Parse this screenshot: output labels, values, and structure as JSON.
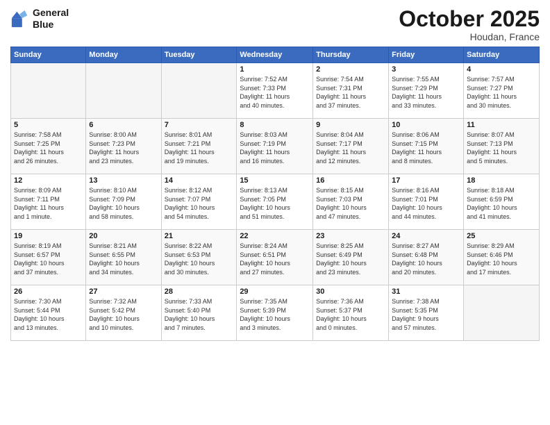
{
  "header": {
    "logo_line1": "General",
    "logo_line2": "Blue",
    "month": "October 2025",
    "location": "Houdan, France"
  },
  "weekdays": [
    "Sunday",
    "Monday",
    "Tuesday",
    "Wednesday",
    "Thursday",
    "Friday",
    "Saturday"
  ],
  "weeks": [
    [
      {
        "day": "",
        "info": ""
      },
      {
        "day": "",
        "info": ""
      },
      {
        "day": "",
        "info": ""
      },
      {
        "day": "1",
        "info": "Sunrise: 7:52 AM\nSunset: 7:33 PM\nDaylight: 11 hours\nand 40 minutes."
      },
      {
        "day": "2",
        "info": "Sunrise: 7:54 AM\nSunset: 7:31 PM\nDaylight: 11 hours\nand 37 minutes."
      },
      {
        "day": "3",
        "info": "Sunrise: 7:55 AM\nSunset: 7:29 PM\nDaylight: 11 hours\nand 33 minutes."
      },
      {
        "day": "4",
        "info": "Sunrise: 7:57 AM\nSunset: 7:27 PM\nDaylight: 11 hours\nand 30 minutes."
      }
    ],
    [
      {
        "day": "5",
        "info": "Sunrise: 7:58 AM\nSunset: 7:25 PM\nDaylight: 11 hours\nand 26 minutes."
      },
      {
        "day": "6",
        "info": "Sunrise: 8:00 AM\nSunset: 7:23 PM\nDaylight: 11 hours\nand 23 minutes."
      },
      {
        "day": "7",
        "info": "Sunrise: 8:01 AM\nSunset: 7:21 PM\nDaylight: 11 hours\nand 19 minutes."
      },
      {
        "day": "8",
        "info": "Sunrise: 8:03 AM\nSunset: 7:19 PM\nDaylight: 11 hours\nand 16 minutes."
      },
      {
        "day": "9",
        "info": "Sunrise: 8:04 AM\nSunset: 7:17 PM\nDaylight: 11 hours\nand 12 minutes."
      },
      {
        "day": "10",
        "info": "Sunrise: 8:06 AM\nSunset: 7:15 PM\nDaylight: 11 hours\nand 8 minutes."
      },
      {
        "day": "11",
        "info": "Sunrise: 8:07 AM\nSunset: 7:13 PM\nDaylight: 11 hours\nand 5 minutes."
      }
    ],
    [
      {
        "day": "12",
        "info": "Sunrise: 8:09 AM\nSunset: 7:11 PM\nDaylight: 11 hours\nand 1 minute."
      },
      {
        "day": "13",
        "info": "Sunrise: 8:10 AM\nSunset: 7:09 PM\nDaylight: 10 hours\nand 58 minutes."
      },
      {
        "day": "14",
        "info": "Sunrise: 8:12 AM\nSunset: 7:07 PM\nDaylight: 10 hours\nand 54 minutes."
      },
      {
        "day": "15",
        "info": "Sunrise: 8:13 AM\nSunset: 7:05 PM\nDaylight: 10 hours\nand 51 minutes."
      },
      {
        "day": "16",
        "info": "Sunrise: 8:15 AM\nSunset: 7:03 PM\nDaylight: 10 hours\nand 47 minutes."
      },
      {
        "day": "17",
        "info": "Sunrise: 8:16 AM\nSunset: 7:01 PM\nDaylight: 10 hours\nand 44 minutes."
      },
      {
        "day": "18",
        "info": "Sunrise: 8:18 AM\nSunset: 6:59 PM\nDaylight: 10 hours\nand 41 minutes."
      }
    ],
    [
      {
        "day": "19",
        "info": "Sunrise: 8:19 AM\nSunset: 6:57 PM\nDaylight: 10 hours\nand 37 minutes."
      },
      {
        "day": "20",
        "info": "Sunrise: 8:21 AM\nSunset: 6:55 PM\nDaylight: 10 hours\nand 34 minutes."
      },
      {
        "day": "21",
        "info": "Sunrise: 8:22 AM\nSunset: 6:53 PM\nDaylight: 10 hours\nand 30 minutes."
      },
      {
        "day": "22",
        "info": "Sunrise: 8:24 AM\nSunset: 6:51 PM\nDaylight: 10 hours\nand 27 minutes."
      },
      {
        "day": "23",
        "info": "Sunrise: 8:25 AM\nSunset: 6:49 PM\nDaylight: 10 hours\nand 23 minutes."
      },
      {
        "day": "24",
        "info": "Sunrise: 8:27 AM\nSunset: 6:48 PM\nDaylight: 10 hours\nand 20 minutes."
      },
      {
        "day": "25",
        "info": "Sunrise: 8:29 AM\nSunset: 6:46 PM\nDaylight: 10 hours\nand 17 minutes."
      }
    ],
    [
      {
        "day": "26",
        "info": "Sunrise: 7:30 AM\nSunset: 5:44 PM\nDaylight: 10 hours\nand 13 minutes."
      },
      {
        "day": "27",
        "info": "Sunrise: 7:32 AM\nSunset: 5:42 PM\nDaylight: 10 hours\nand 10 minutes."
      },
      {
        "day": "28",
        "info": "Sunrise: 7:33 AM\nSunset: 5:40 PM\nDaylight: 10 hours\nand 7 minutes."
      },
      {
        "day": "29",
        "info": "Sunrise: 7:35 AM\nSunset: 5:39 PM\nDaylight: 10 hours\nand 3 minutes."
      },
      {
        "day": "30",
        "info": "Sunrise: 7:36 AM\nSunset: 5:37 PM\nDaylight: 10 hours\nand 0 minutes."
      },
      {
        "day": "31",
        "info": "Sunrise: 7:38 AM\nSunset: 5:35 PM\nDaylight: 9 hours\nand 57 minutes."
      },
      {
        "day": "",
        "info": ""
      }
    ]
  ]
}
